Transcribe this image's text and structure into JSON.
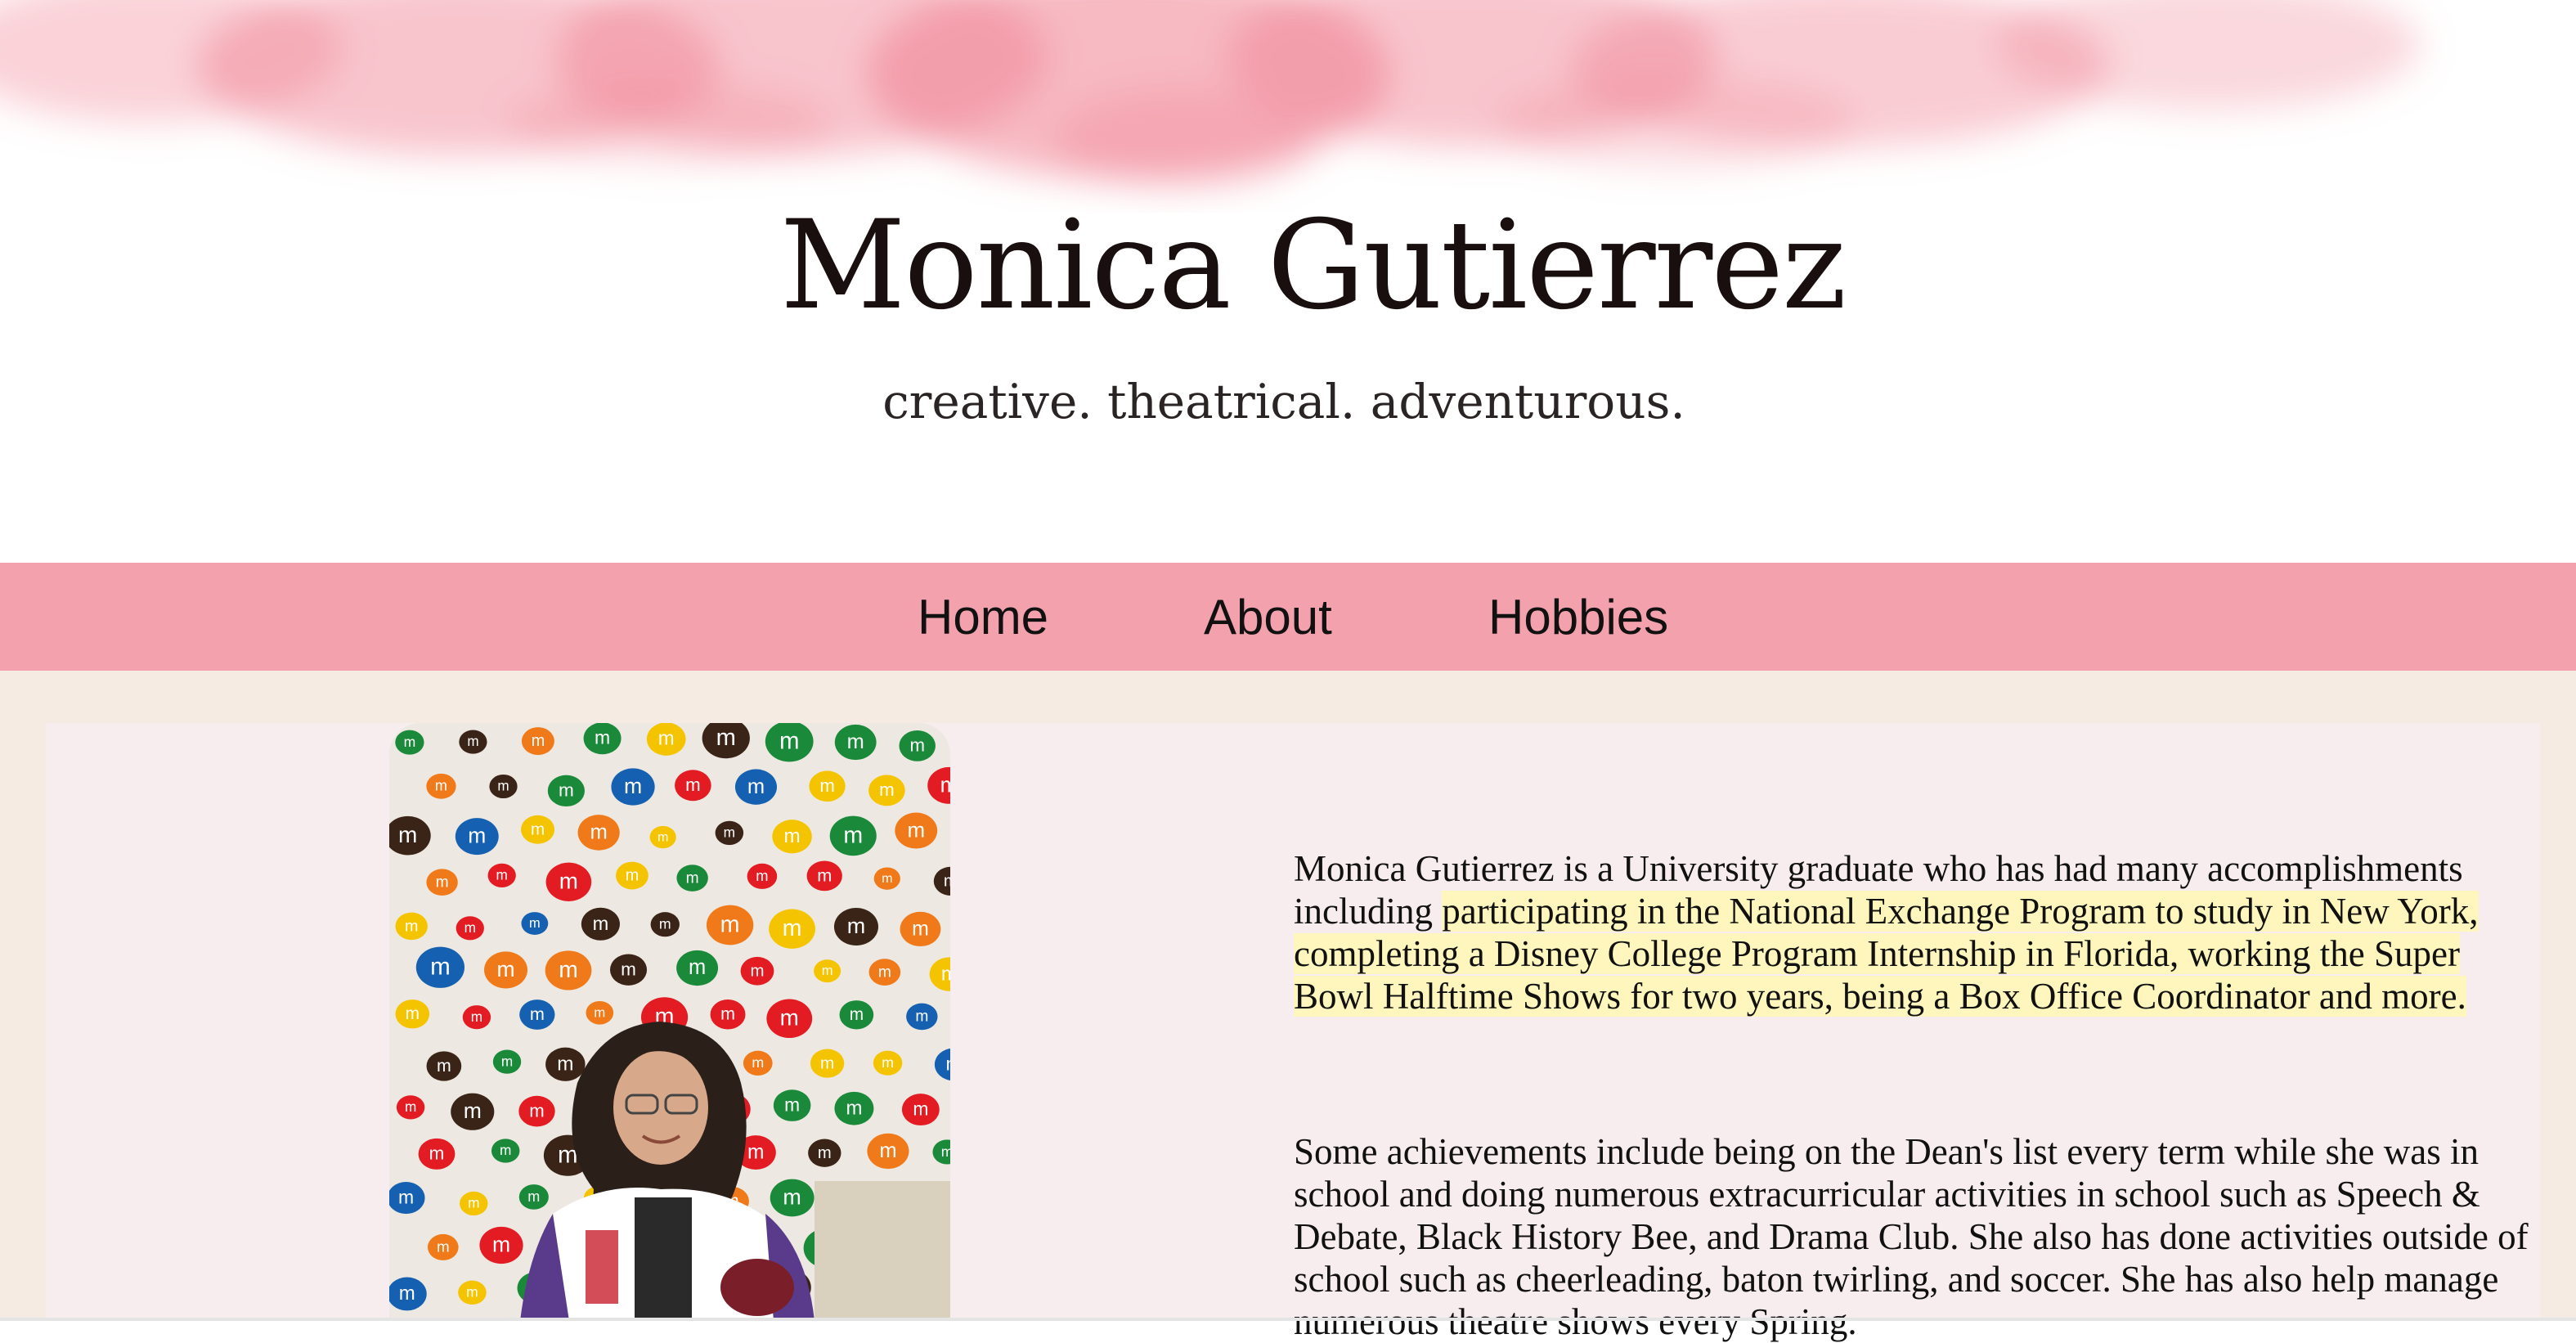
{
  "header": {
    "title": "Monica Gutierrez",
    "tagline": "creative. theatrical. adventurous."
  },
  "nav": {
    "items": [
      "Home",
      "About",
      "Hobbies"
    ]
  },
  "content": {
    "photo_icon": "portrait-photo",
    "bio_p1_before": "Monica Gutierrez is a University graduate who has had many accomplishments including ",
    "bio_p1_highlight": "participating in the National Exchange Program to study in New York, completing a Disney College Program Internship in Florida, working the Super Bowl Halftime Shows for two years, being a Box Office Coordinator and more.",
    "bio_p2": "Some achievements include being on the Dean's list every term while she was in school and doing numerous extracurricular activities in school such as Speech & Debate, Black History Bee, and Drama Club. She also has done activities outside of school such as cheerleading, baton twirling, and soccer. She has also help manage numerous theatre shows every Spring."
  },
  "colors": {
    "nav_bg": "#f2a1ad",
    "page_bg": "#f6ebe3",
    "panel_bg": "#f7ecee",
    "highlight": "#fff6bd",
    "wash": "#f07f90"
  }
}
